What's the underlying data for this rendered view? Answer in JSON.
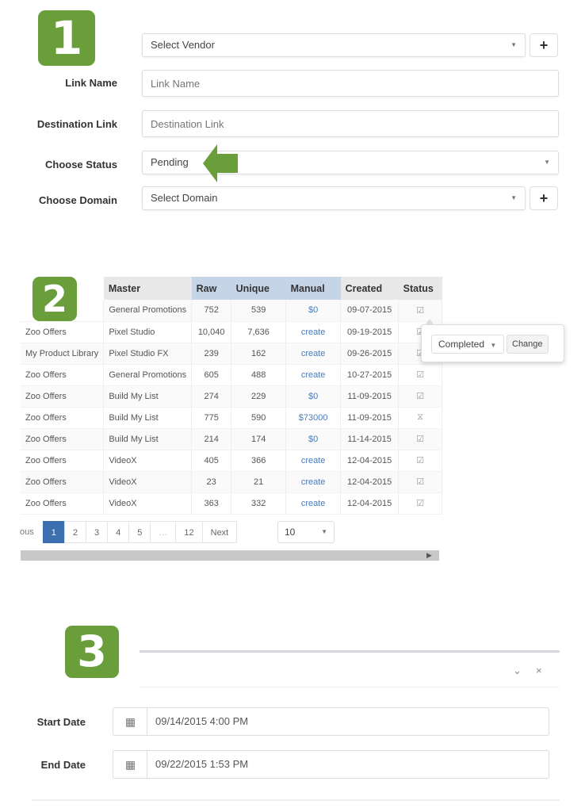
{
  "section1": {
    "badge": "1",
    "vendor_select": "Select Vendor",
    "link_name": {
      "label": "Link Name",
      "placeholder": "Link Name"
    },
    "destination_link": {
      "label": "Destination Link",
      "placeholder": "Destination Link"
    },
    "status": {
      "label": "Choose Status",
      "value": "Pending"
    },
    "domain": {
      "label": "Choose Domain",
      "value": "Select Domain"
    },
    "plus": "+",
    "caret": "▼"
  },
  "section2": {
    "badge": "2",
    "columns": [
      "",
      "Master",
      "Raw",
      "Unique",
      "Manual",
      "Created",
      "Status"
    ],
    "rows": [
      [
        "",
        "General Promotions",
        "752",
        "539",
        "$0",
        "09-07-2015",
        "☑"
      ],
      [
        "Zoo Offers",
        "Pixel Studio",
        "10,040",
        "7,636",
        "create",
        "09-19-2015",
        "☑"
      ],
      [
        "My Product Library",
        "Pixel Studio FX",
        "239",
        "162",
        "create",
        "09-26-2015",
        "☑"
      ],
      [
        "Zoo Offers",
        "General Promotions",
        "605",
        "488",
        "create",
        "10-27-2015",
        "☑"
      ],
      [
        "Zoo Offers",
        "Build My List",
        "274",
        "229",
        "$0",
        "11-09-2015",
        "☑"
      ],
      [
        "Zoo Offers",
        "Build My List",
        "775",
        "590",
        "$73000",
        "11-09-2015",
        "⧖"
      ],
      [
        "Zoo Offers",
        "Build My List",
        "214",
        "174",
        "$0",
        "11-14-2015",
        "☑"
      ],
      [
        "Zoo Offers",
        "VideoX",
        "405",
        "366",
        "create",
        "12-04-2015",
        "☑"
      ],
      [
        "Zoo Offers",
        "VideoX",
        "23",
        "21",
        "create",
        "12-04-2015",
        "☑"
      ],
      [
        "Zoo Offers",
        "VideoX",
        "363",
        "332",
        "create",
        "12-04-2015",
        "☑"
      ]
    ],
    "pagination": {
      "prev": "ous",
      "pages": [
        "1",
        "2",
        "3",
        "4",
        "5",
        "…",
        "12"
      ],
      "active": "1",
      "next": "Next"
    },
    "per_page": "10",
    "popover": {
      "select_value": "Completed",
      "button": "Change"
    }
  },
  "section3": {
    "badge": "3",
    "start_date": {
      "label": "Start Date",
      "value": "09/14/2015 4:00 PM"
    },
    "end_date": {
      "label": "End Date",
      "value": "09/22/2015 1:53 PM"
    },
    "collapse": "⌄",
    "close": "×",
    "calendar": "▦"
  },
  "colors": {
    "badge_green": "#6a9e3a",
    "header_blue": "#c6d4e8",
    "link_blue": "#4a7ab8",
    "active_page": "#3a6fb0"
  }
}
